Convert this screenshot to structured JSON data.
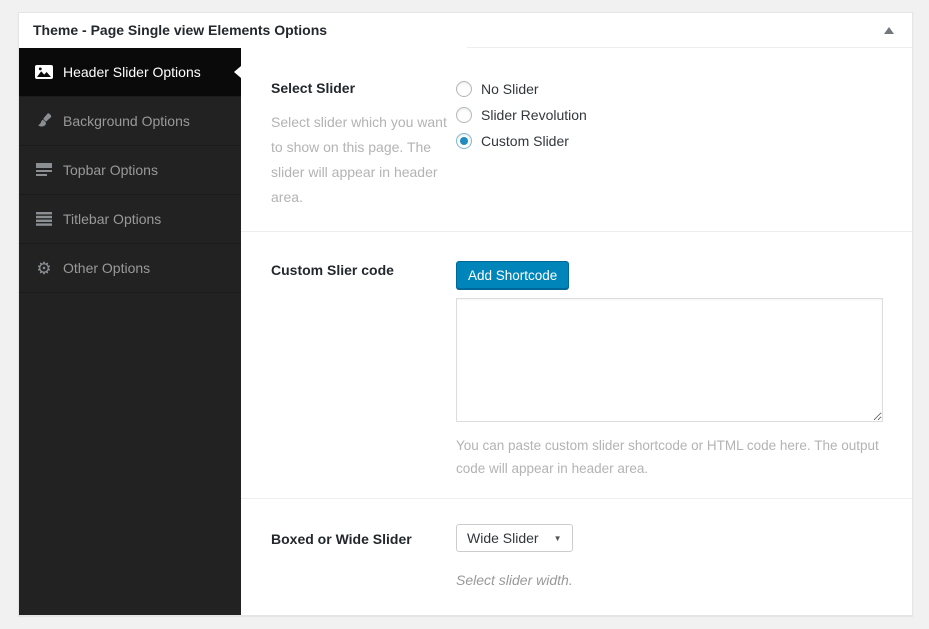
{
  "metabox": {
    "title": "Theme - Page Single view Elements Options"
  },
  "sidebar": {
    "items": [
      {
        "label": "Header Slider Options",
        "icon": "image-icon",
        "active": true
      },
      {
        "label": "Background Options",
        "icon": "brush-icon",
        "active": false
      },
      {
        "label": "Topbar Options",
        "icon": "topbar-icon",
        "active": false
      },
      {
        "label": "Titlebar Options",
        "icon": "titlebar-icon",
        "active": false
      },
      {
        "label": "Other Options",
        "icon": "gear-icon",
        "active": false
      }
    ]
  },
  "sections": [
    {
      "label": "Select Slider",
      "description": "Select slider which you want to show on this page. The slider will appear in header area.",
      "radio_options": [
        {
          "label": "No Slider",
          "selected": false
        },
        {
          "label": "Slider Revolution",
          "selected": false
        },
        {
          "label": "Custom Slider",
          "selected": true
        }
      ]
    },
    {
      "label": "Custom Slier code",
      "button_label": "Add Shortcode",
      "textarea_value": "",
      "description": "You can paste custom slider shortcode or HTML code here. The output code will appear in header area."
    },
    {
      "label": "Boxed or Wide Slider",
      "select_value": "Wide Slider",
      "description": "Select slider width."
    }
  ],
  "colors": {
    "button_blue": "#0085ba",
    "radio_selected_blue": "#1e8cbe",
    "sidebar_bg": "#222222",
    "sidebar_active_bg": "#0a0a0a",
    "page_bg": "#f1f1f1"
  }
}
